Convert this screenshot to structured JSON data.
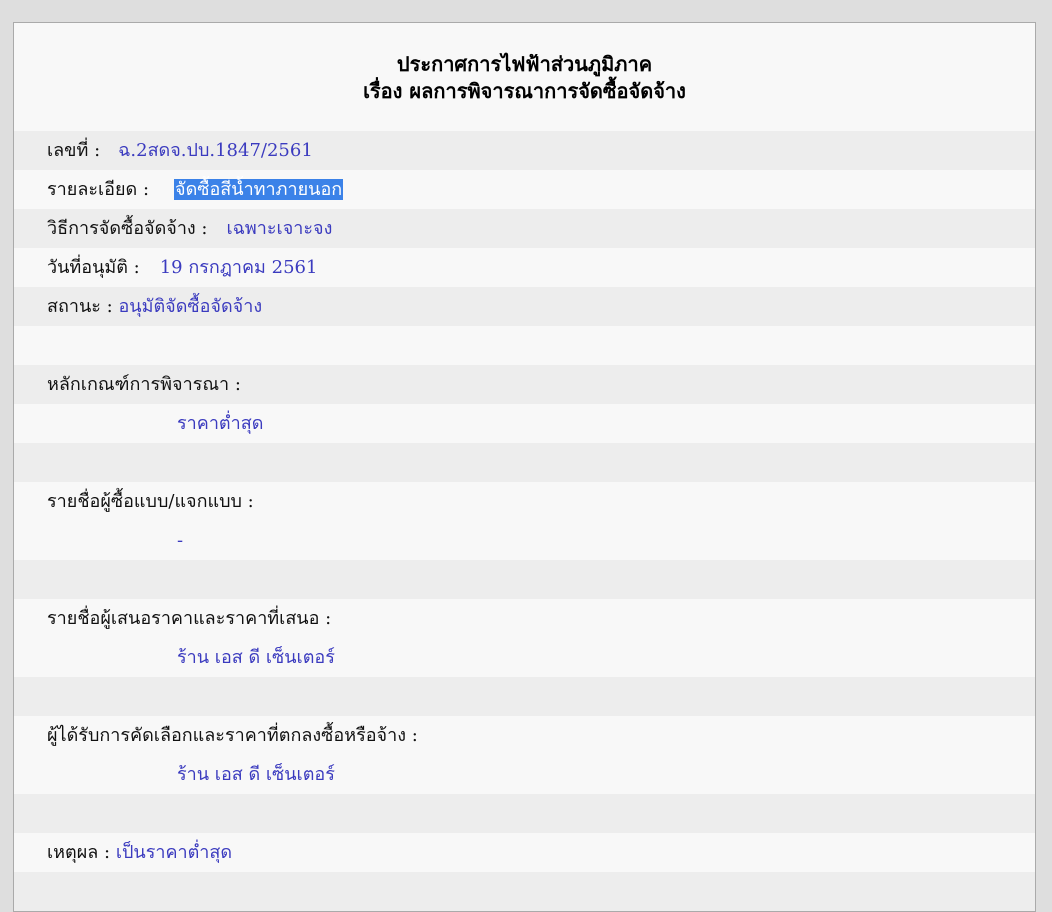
{
  "header": {
    "line1": "ประกาศการไฟฟ้าส่วนภูมิภาค",
    "line2": "เรื่อง ผลการพิจารณาการจัดซื้อจัดจ้าง"
  },
  "fields": {
    "number": {
      "label": "เลขที่ :",
      "value": "ฉ.2สดจ.ปบ.1847/2561"
    },
    "detail": {
      "label": "รายละเอียด :",
      "value": "จัดซื้อสีน้ำทาภายนอก"
    },
    "method": {
      "label": "วิธีการจัดซื้อจัดจ้าง :",
      "value": "เฉพาะเจาะจง"
    },
    "approval_date": {
      "label": "วันที่อนุมัติ :",
      "value": "19 กรกฎาคม 2561"
    },
    "status": {
      "label": "สถานะ :",
      "value": "อนุมัติจัดซื้อจัดจ้าง"
    }
  },
  "sections": {
    "criteria": {
      "label": "หลักเกณฑ์การพิจารณา :",
      "value": "ราคาต่ำสุด"
    },
    "buyers": {
      "label": "รายชื่อผู้ซื้อแบบ/แจกแบบ :",
      "value": "-"
    },
    "bidders": {
      "label": "รายชื่อผู้เสนอราคาและราคาที่เสนอ :",
      "value": "ร้าน เอส ดี เซ็นเตอร์"
    },
    "winner": {
      "label": "ผู้ได้รับการคัดเลือกและราคาที่ตกลงซื้อหรือจ้าง :",
      "value": "ร้าน เอส ดี เซ็นเตอร์"
    },
    "reason": {
      "label": "เหตุผล :",
      "value": "เป็นราคาต่ำสุด"
    }
  },
  "colors": {
    "value_text": "#3b3bbf",
    "row_alt_bg": "#ededed",
    "panel_bg": "#f8f8f8",
    "selection_bg": "#3b82e8"
  }
}
